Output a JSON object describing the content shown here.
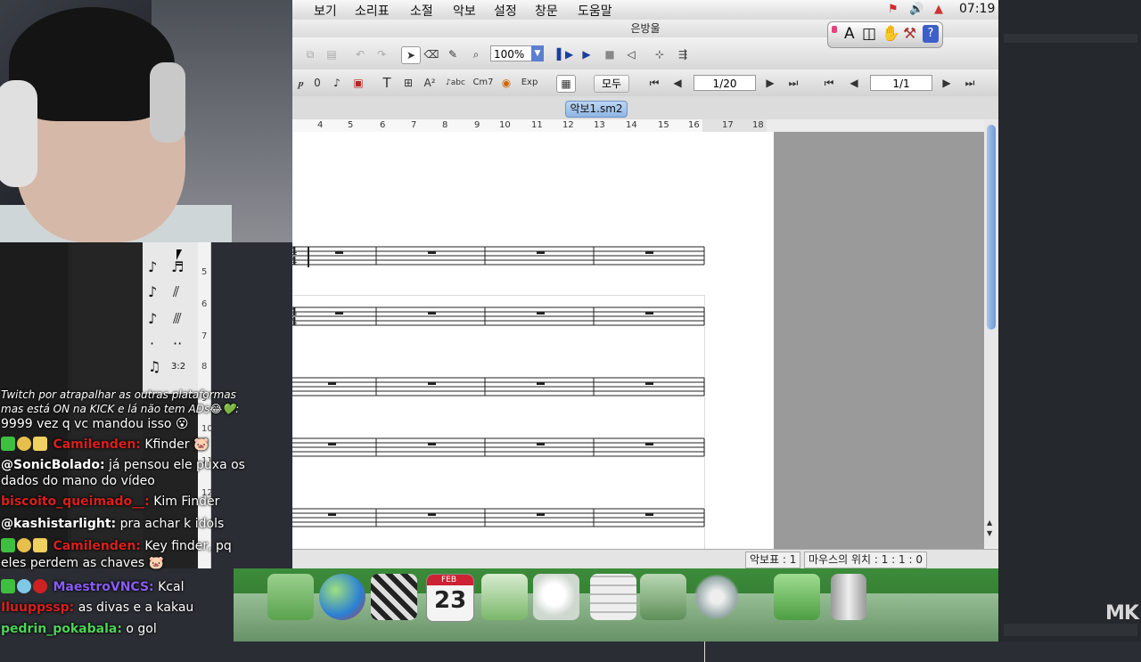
{
  "menubar": {
    "items": [
      "보기",
      "소리표",
      "소절",
      "악보",
      "설정",
      "창문",
      "도움말"
    ],
    "clock": "07:19"
  },
  "window": {
    "title": "은방울",
    "zoom": "100%",
    "all_button": "모두",
    "page_counter": "1/20",
    "part_counter": "1/1",
    "doc_tab": "악보1.sm2",
    "ruler_numbers": [
      "4",
      "5",
      "6",
      "7",
      "8",
      "9",
      "10",
      "11",
      "12",
      "13",
      "14",
      "15",
      "16",
      "17",
      "18"
    ],
    "toolbar2_labels": {
      "digit": "0",
      "text_tool": "T",
      "chord_tool": "Cm7",
      "expression_tool": "Exp",
      "lyric_tool": "♪abc"
    },
    "status": {
      "score_label": "악보표 : 1",
      "mouse_label": "마우스의 위치 : 1 : 1 : 0"
    },
    "staff": {
      "time_sig_top": "4",
      "time_sig_bottom": "4"
    }
  },
  "palette": {
    "icons": [
      "text-a-icon",
      "columns-icon",
      "hand-icon",
      "tools-icon",
      "help-icon"
    ],
    "a_label": "A",
    "help_label": "?"
  },
  "left_rows": [
    "5",
    "6",
    "7",
    "8",
    "9",
    "10",
    "11",
    "12"
  ],
  "note_palette": {
    "tuplet_label": "3:2"
  },
  "chat": {
    "lines": [
      {
        "user": "",
        "text": "Twitch por atrapalhar as outras plataformas",
        "italic": true
      },
      {
        "user": "",
        "text": "mas está ON na KICK e lá não tem ADs😂💚:",
        "italic": true
      },
      {
        "user": "",
        "text": "9999 vez q vc mandou isso 😮"
      },
      {
        "user": "Camilenden:",
        "text": "Kfinder 🐷",
        "color": "#d8201e"
      },
      {
        "user": "@SonicBolado:",
        "text": "já pensou ele puxa os",
        "color": "#ffffff"
      },
      {
        "user": "",
        "text": "dados do mano do vídeo"
      },
      {
        "user": "biscoito_queimado__:",
        "text": "Kim Finder",
        "color": "#d8201e"
      },
      {
        "user": "@kashistarlight:",
        "text": "pra achar k idols",
        "color": "#ffffff"
      },
      {
        "user": "Camilenden:",
        "text": "Key finder, pq",
        "color": "#d8201e"
      },
      {
        "user": "",
        "text": "eles perdem as chaves 🐷"
      },
      {
        "user": "MaestroVNCS:",
        "text": "Kcal",
        "color": "#8a5cf5"
      },
      {
        "user": "Iluuppssp:",
        "text": "as divas e a kakau",
        "color": "#d8201e"
      },
      {
        "user": "pedrin_pokabala:",
        "text": "o gol",
        "color": "#4fd35a"
      }
    ]
  },
  "dock": {
    "calendar_month": "FEB",
    "calendar_day": "23",
    "icons": [
      "folder-icon",
      "globe-icon",
      "clapperboard-icon",
      "calendar-icon",
      "address-book-icon",
      "preview-icon",
      "calculator-icon",
      "utilities-icon",
      "music-app-icon",
      "green-folder-icon",
      "trash-icon"
    ]
  },
  "watermark": "MK"
}
